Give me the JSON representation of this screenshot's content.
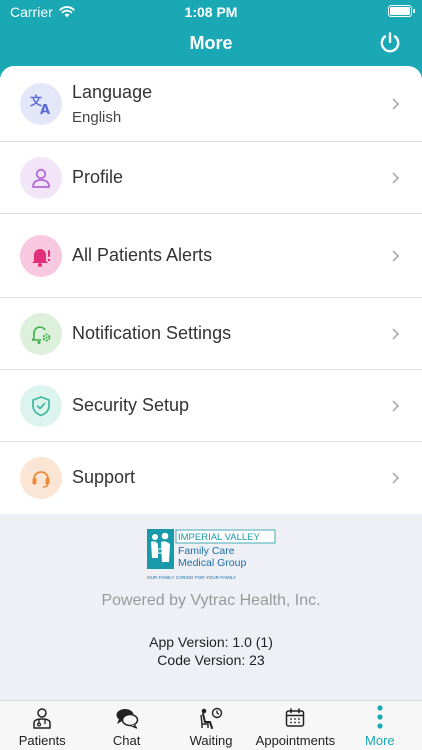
{
  "status_bar": {
    "carrier": "Carrier",
    "time": "1:08 PM"
  },
  "header": {
    "title": "More"
  },
  "menu": [
    {
      "label": "Language",
      "sub": "English",
      "icon": "translate-icon",
      "icon_bg": "#e4e7f7",
      "icon_color": "#5b6bd6"
    },
    {
      "label": "Profile",
      "icon": "user-icon",
      "icon_bg": "#f1e5f7",
      "icon_color": "#b06ad9"
    },
    {
      "label": "All Patients Alerts",
      "icon": "bell-alert-icon",
      "icon_bg": "#f7c8df",
      "icon_color": "#e0307a"
    },
    {
      "label": "Notification Settings",
      "icon": "bell-gear-icon",
      "icon_bg": "#dcf0dc",
      "icon_color": "#3cae4a"
    },
    {
      "label": "Security Setup",
      "icon": "shield-check-icon",
      "icon_bg": "#dcf3ee",
      "icon_color": "#3fb9a0"
    },
    {
      "label": "Support",
      "icon": "headset-icon",
      "icon_bg": "#fbe6d6",
      "icon_color": "#ee8a35"
    }
  ],
  "footer": {
    "logo": {
      "line1": "IMPERIAL VALLEY",
      "line2": "Family Care",
      "line3": "Medical Group",
      "tagline": "OUR FAMILY CARING FOR YOUR FAMILY"
    },
    "powered_by": "Powered by Vytrac Health, Inc.",
    "app_version": "App Version: 1.0 (1)",
    "code_version": "Code Version: 23"
  },
  "tabs": [
    {
      "label": "Patients",
      "icon": "doctor-icon"
    },
    {
      "label": "Chat",
      "icon": "chat-icon"
    },
    {
      "label": "Waiting",
      "icon": "waiting-chair-icon"
    },
    {
      "label": "Appointments",
      "icon": "calendar-icon"
    },
    {
      "label": "More",
      "icon": "more-vertical-icon",
      "active": true
    }
  ],
  "colors": {
    "brand": "#1ba8b5",
    "chevron": "#b0b0b5"
  }
}
